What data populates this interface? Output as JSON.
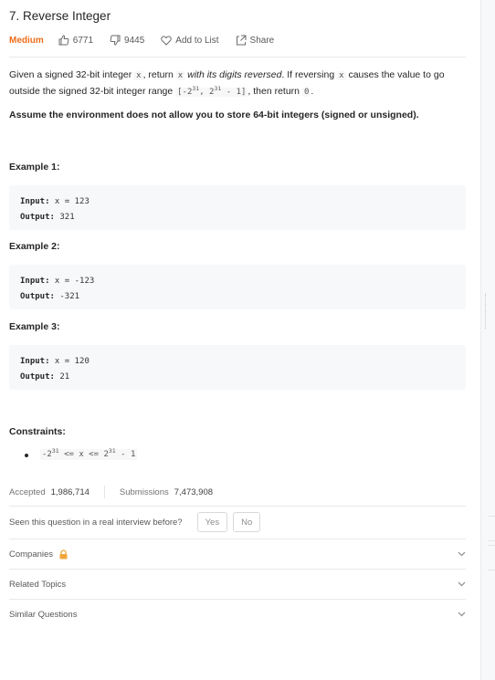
{
  "problem": {
    "number_title": "7. Reverse Integer",
    "difficulty": "Medium",
    "likes": "6771",
    "dislikes": "9445",
    "add_to_list": "Add to List",
    "share": "Share"
  },
  "description": {
    "p1_a": "Given a signed 32-bit integer ",
    "x1": "x",
    "p1_b": ", return ",
    "x2": "x",
    "p1_italic": " with its digits reversed",
    "p1_c": ". If reversing ",
    "x3": "x",
    "p1_d": " causes the value to go outside the signed 32-bit integer range ",
    "range_a": "[-2",
    "range_exp1": "31",
    "range_b": ", 2",
    "range_exp2": "31",
    "range_c": " - 1]",
    "p1_e": ", then return ",
    "zero": "0",
    "p1_f": ".",
    "note": "Assume the environment does not allow you to store 64-bit integers (signed or unsigned)."
  },
  "examples": [
    {
      "title": "Example 1:",
      "input_label": "Input:",
      "input": " x = 123",
      "output_label": "Output:",
      "output": " 321"
    },
    {
      "title": "Example 2:",
      "input_label": "Input:",
      "input": " x = -123",
      "output_label": "Output:",
      "output": " -321"
    },
    {
      "title": "Example 3:",
      "input_label": "Input:",
      "input": " x = 120",
      "output_label": "Output:",
      "output": " 21"
    }
  ],
  "constraints": {
    "title": "Constraints:",
    "c_a": "-2",
    "c_exp1": "31",
    "c_b": " <= x <= 2",
    "c_exp2": "31",
    "c_c": " - 1"
  },
  "stats": {
    "accepted_label": "Accepted",
    "accepted_value": "1,986,714",
    "submissions_label": "Submissions",
    "submissions_value": "7,473,908"
  },
  "interview": {
    "question": "Seen this question in a real interview before?",
    "yes": "Yes",
    "no": "No"
  },
  "sections": {
    "companies": "Companies",
    "related_topics": "Related Topics",
    "similar_questions": "Similar Questions"
  },
  "colors": {
    "difficulty_medium": "#ef6c1b",
    "lock_icon": "#f0a63b"
  }
}
